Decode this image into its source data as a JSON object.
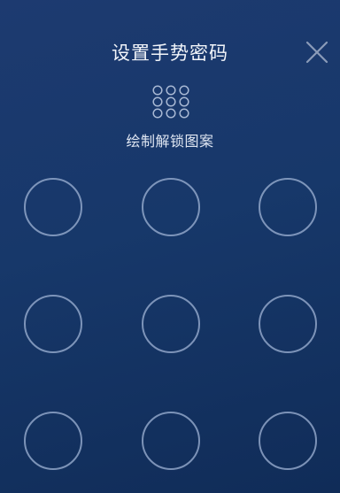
{
  "header": {
    "title": "设置手势密码",
    "close_icon": "close-icon"
  },
  "pattern": {
    "preview_icon": "pattern-preview-icon",
    "hint": "绘制解锁图案",
    "grid_size": "3x3",
    "nodes": [
      {
        "id": 1,
        "selected": false
      },
      {
        "id": 2,
        "selected": false
      },
      {
        "id": 3,
        "selected": false
      },
      {
        "id": 4,
        "selected": false
      },
      {
        "id": 5,
        "selected": false
      },
      {
        "id": 6,
        "selected": false
      },
      {
        "id": 7,
        "selected": false
      },
      {
        "id": 8,
        "selected": false
      },
      {
        "id": 9,
        "selected": false
      }
    ]
  },
  "colors": {
    "background_top": "#1d3a70",
    "background_bottom": "#102c58",
    "node_ring": "#a0b4d6",
    "text": "#f2f5fa"
  }
}
